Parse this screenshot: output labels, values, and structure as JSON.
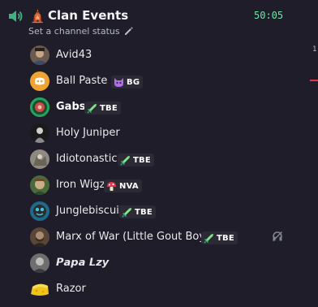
{
  "channel": {
    "icon": "speaker-icon",
    "emoji": "🛕",
    "name": "Clan Events",
    "timer": "50:05",
    "status_placeholder": "Set a channel status",
    "accent_color": "#6ee6a6"
  },
  "edge": {
    "number": "1"
  },
  "members": [
    {
      "name": "Avid43"
    },
    {
      "name": "Ball Paste",
      "tag_icon": "demon-icon",
      "tag": "BG"
    },
    {
      "name": "Gabs",
      "tag_icon": "sword-icon",
      "tag": "TBE",
      "speaking": true
    },
    {
      "name": "Holy Juniper"
    },
    {
      "name": "Idiotonastic",
      "tag_icon": "sword-icon",
      "tag": "TBE"
    },
    {
      "name": "Iron Wigz",
      "tag_icon": "mushroom-icon",
      "tag": "NVA"
    },
    {
      "name": "Junglebiscuit",
      "tag_icon": "sword-icon",
      "tag": "TBE"
    },
    {
      "name": "Marx of War (Little Gout Boy)",
      "tag_icon": "sword-icon",
      "tag": "TBE",
      "deafened": true
    },
    {
      "name": "𝙋𝙖𝙥𝙖 𝙇𝙯𝙮"
    },
    {
      "name": "Razor"
    }
  ]
}
